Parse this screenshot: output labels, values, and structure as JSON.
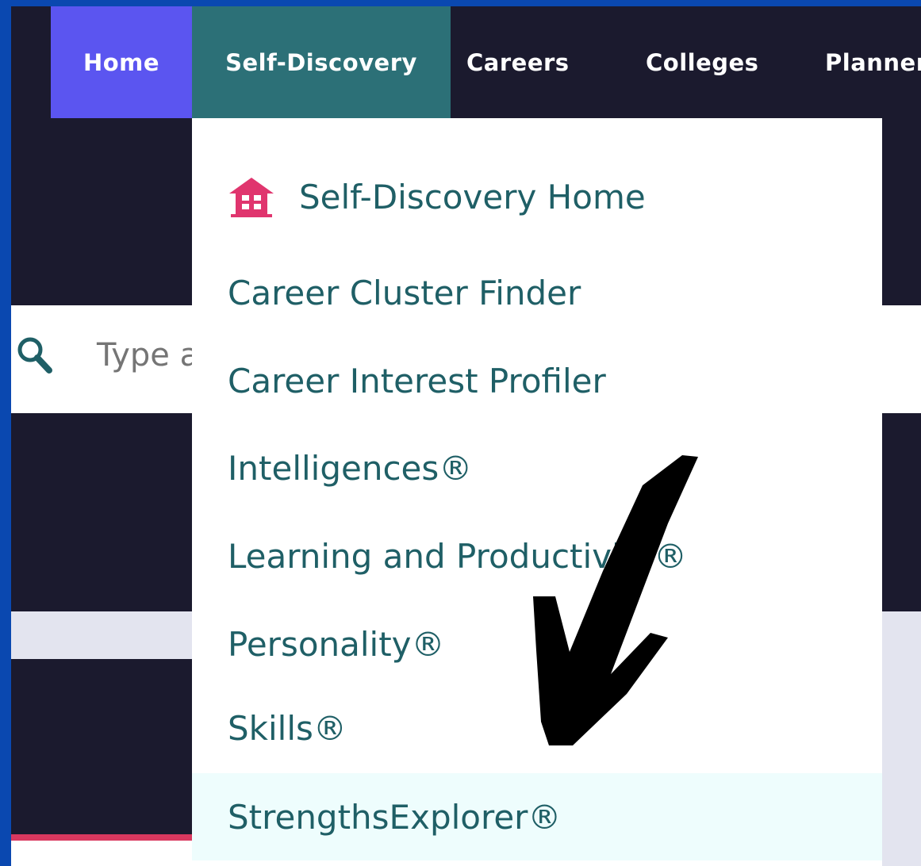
{
  "nav": {
    "items": [
      {
        "label": "Home"
      },
      {
        "label": "Self-Discovery"
      },
      {
        "label": "Careers"
      },
      {
        "label": "Colleges"
      },
      {
        "label": "Planner"
      }
    ]
  },
  "search": {
    "value": "Type a"
  },
  "dropdown": {
    "items": [
      {
        "label": "Self-Discovery Home",
        "icon": "home-icon"
      },
      {
        "label": "Career Cluster Finder"
      },
      {
        "label": "Career Interest Profiler"
      },
      {
        "label": "Intelligences®"
      },
      {
        "label": "Learning and Productivity®"
      },
      {
        "label": "Personality®"
      },
      {
        "label": "Skills®"
      },
      {
        "label": "StrengthsExplorer®",
        "highlighted": true
      }
    ]
  },
  "colors": {
    "frame": "#0a48b0",
    "nav_bg": "#1b1a2e",
    "home_tab": "#5b55f0",
    "active_tab": "#2c7077",
    "menu_text": "#1f5f66",
    "home_icon": "#e0356e"
  }
}
